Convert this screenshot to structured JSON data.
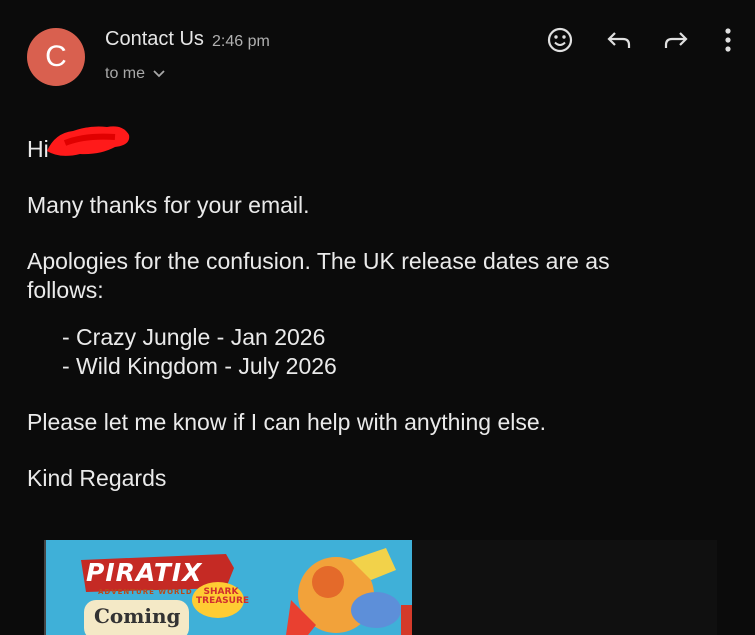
{
  "header": {
    "avatar_letter": "C",
    "sender": "Contact Us",
    "time": "2:46 pm",
    "to_label": "to me"
  },
  "icons": {
    "emoji": "emoji-react-icon",
    "reply": "reply-icon",
    "forward": "forward-icon",
    "more": "more-vert-icon"
  },
  "colors": {
    "background": "#0b0b0b",
    "avatar": "#d9604f",
    "redaction": "#ff1a1a"
  },
  "message": {
    "greeting": "Hi",
    "line1": "Many thanks for your email.",
    "line2": "Apologies for the confusion. The UK release dates are as follows:",
    "items": [
      "- Crazy Jungle - Jan 2026",
      "- Wild Kingdom - July 2026"
    ],
    "line3": "Please let me know if I can help with anything else.",
    "signoff": "Kind Regards"
  },
  "banner": {
    "logo": "PIRATIX",
    "subtitle": "ADVENTURE WORLD",
    "badge": "SHARK TREASURE",
    "coming": "Coming"
  }
}
